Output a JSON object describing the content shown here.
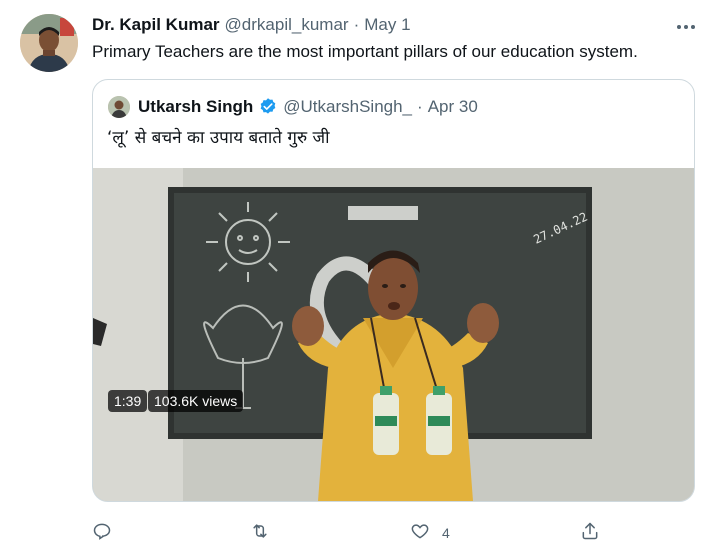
{
  "tweet": {
    "author_name": "Dr. Kapil Kumar",
    "author_handle": "@drkapil_kumar",
    "separator": "·",
    "date": "May 1",
    "text": "Primary Teachers are the most important pillars of our education system."
  },
  "quoted_tweet": {
    "author_name": "Utkarsh Singh",
    "author_handle": "@UtkarshSingh_",
    "separator": "·",
    "date": "Apr 30",
    "text": "‘लू’ से बचने का उपाय बताते गुरु जी",
    "video": {
      "duration": "1:39",
      "views": "103.6K views",
      "board_date_text": "27.04.22"
    }
  },
  "actions": {
    "reply_count": "",
    "retweet_count": "",
    "like_count": "4"
  },
  "colors": {
    "text_primary": "#0f1419",
    "text_muted": "#536471",
    "border": "#cfd9de",
    "verified_blue": "#1d9bf0"
  },
  "icons": [
    "more-icon",
    "verified-badge-icon",
    "reply-icon",
    "retweet-icon",
    "like-icon",
    "share-icon"
  ]
}
